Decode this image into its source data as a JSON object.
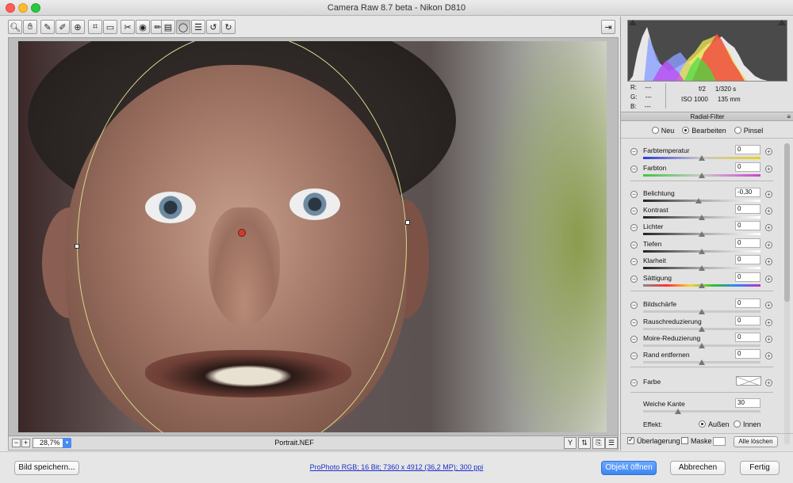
{
  "window": {
    "title": "Camera Raw 8.7 beta - Nikon D810"
  },
  "toolbar": {
    "tools": [
      "zoom-icon",
      "hand-icon",
      "white-balance-icon",
      "color-sampler-icon",
      "target-adjust-icon",
      "crop-icon",
      "straighten-icon",
      "spot-removal-icon",
      "red-eye-icon",
      "adjustment-brush-icon",
      "graduated-filter-icon",
      "radial-filter-icon",
      "preferences-icon",
      "rotate-ccw-icon",
      "rotate-cw-icon"
    ],
    "fullscreen_icon": "fullscreen-toggle-icon"
  },
  "status": {
    "zoom_value": "28,7%",
    "filename": "Portrait.NEF",
    "zoom_minus": "−",
    "zoom_plus": "+"
  },
  "info": {
    "r": "R:",
    "g": "G:",
    "b": "B:",
    "r_val": "---",
    "g_val": "---",
    "b_val": "---",
    "aperture": "f/2",
    "shutter": "1/320 s",
    "iso": "ISO 1000",
    "focal": "135 mm"
  },
  "panel": {
    "section_title": "Radial-Filter",
    "mode_new": "Neu",
    "mode_edit": "Bearbeiten",
    "mode_brush": "Pinsel",
    "sliders": [
      {
        "label": "Farbtemperatur",
        "value": "0",
        "pos": 0.5,
        "track": "temp"
      },
      {
        "label": "Farbton",
        "value": "0",
        "pos": 0.5,
        "track": "tint"
      },
      {
        "label": "Belichtung",
        "value": "-0,30",
        "pos": 0.47,
        "track": "gray"
      },
      {
        "label": "Kontrast",
        "value": "0",
        "pos": 0.5,
        "track": "gray"
      },
      {
        "label": "Lichter",
        "value": "0",
        "pos": 0.5,
        "track": "gray"
      },
      {
        "label": "Tiefen",
        "value": "0",
        "pos": 0.5,
        "track": "gray"
      },
      {
        "label": "Klarheit",
        "value": "0",
        "pos": 0.5,
        "track": "gray"
      },
      {
        "label": "Sättigung",
        "value": "0",
        "pos": 0.5,
        "track": "sat"
      },
      {
        "label": "Bildschärfe",
        "value": "0",
        "pos": 0.5,
        "track": "flat"
      },
      {
        "label": "Rauschreduzierung",
        "value": "0",
        "pos": 0.5,
        "track": "flat"
      },
      {
        "label": "Moire-Reduzierung",
        "value": "0",
        "pos": 0.5,
        "track": "flat"
      },
      {
        "label": "Rand entfernen",
        "value": "0",
        "pos": 0.5,
        "track": "flat"
      }
    ],
    "farbe_label": "Farbe",
    "feather_label": "Weiche Kante",
    "feather_value": "30",
    "feather_pos": 0.3,
    "effect_label": "Effekt:",
    "effect_outside": "Außen",
    "effect_inside": "Innen",
    "overlay_label": "Überlagerung",
    "mask_label": "Maske",
    "clear_all": "Alle löschen"
  },
  "footer": {
    "save_button": "Bild speichern...",
    "workflow_link": "ProPhoto RGB; 16 Bit; 7360 x 4912 (36,2 MP); 300 ppi",
    "open_object": "Objekt öffnen",
    "cancel": "Abbrechen",
    "done": "Fertig"
  },
  "colors": {
    "accent": "#3c86f2",
    "radial_pin": "#c9402e",
    "ellipse": "#d4d98c"
  }
}
